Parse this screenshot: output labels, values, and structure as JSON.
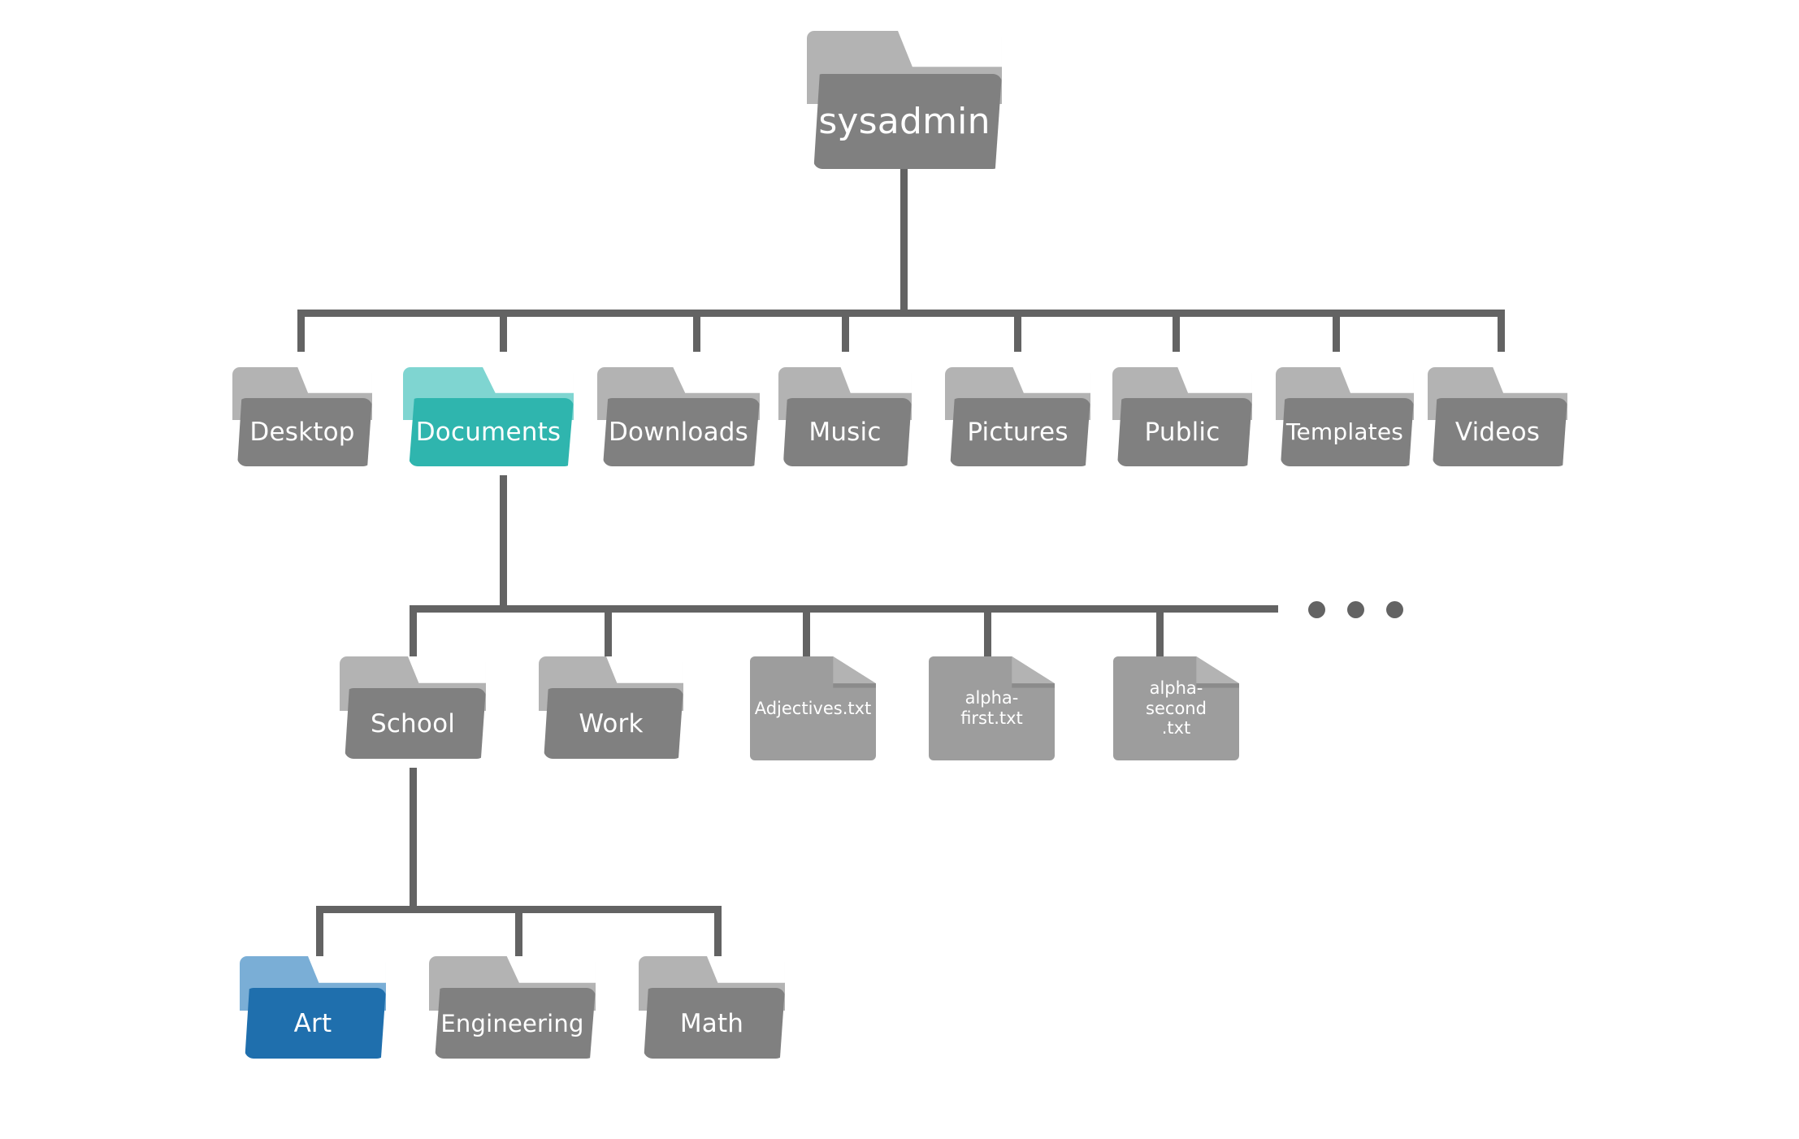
{
  "diagram": {
    "title": "sysadmin home directory tree",
    "colors": {
      "connector": "#636363",
      "folder_default_front": "#808080",
      "folder_default_tab": "#b3b3b3",
      "folder_documents_front": "#2fb5ae",
      "folder_documents_tab": "#7fd5d1",
      "folder_art_front": "#1f6fad",
      "folder_art_tab": "#7aaed6",
      "file_sheet": "#9d9d9d",
      "file_fold": "#b3b3b3",
      "background": "#ffffff",
      "label_text": "#ffffff"
    }
  },
  "root": {
    "label": "sysadmin",
    "type": "folder"
  },
  "level2": [
    {
      "label": "Desktop",
      "type": "folder",
      "highlight": "none"
    },
    {
      "label": "Documents",
      "type": "folder",
      "highlight": "teal"
    },
    {
      "label": "Downloads",
      "type": "folder",
      "highlight": "none"
    },
    {
      "label": "Music",
      "type": "folder",
      "highlight": "none"
    },
    {
      "label": "Pictures",
      "type": "folder",
      "highlight": "none"
    },
    {
      "label": "Public",
      "type": "folder",
      "highlight": "none"
    },
    {
      "label": "Templates",
      "type": "folder",
      "highlight": "none"
    },
    {
      "label": "Videos",
      "type": "folder",
      "highlight": "none"
    }
  ],
  "level3": [
    {
      "label": "School",
      "type": "folder",
      "highlight": "none"
    },
    {
      "label": "Work",
      "type": "folder",
      "highlight": "none"
    },
    {
      "label": "Adjectives.txt",
      "type": "file"
    },
    {
      "label": "alpha-first.txt",
      "type": "file"
    },
    {
      "label": "alpha-second\n.txt",
      "type": "file"
    }
  ],
  "level3_overflow": {
    "indicator": "ellipsis",
    "dot_count": 3
  },
  "level4": [
    {
      "label": "Art",
      "type": "folder",
      "highlight": "blue"
    },
    {
      "label": "Engineering",
      "type": "folder",
      "highlight": "none"
    },
    {
      "label": "Math",
      "type": "folder",
      "highlight": "none"
    }
  ]
}
